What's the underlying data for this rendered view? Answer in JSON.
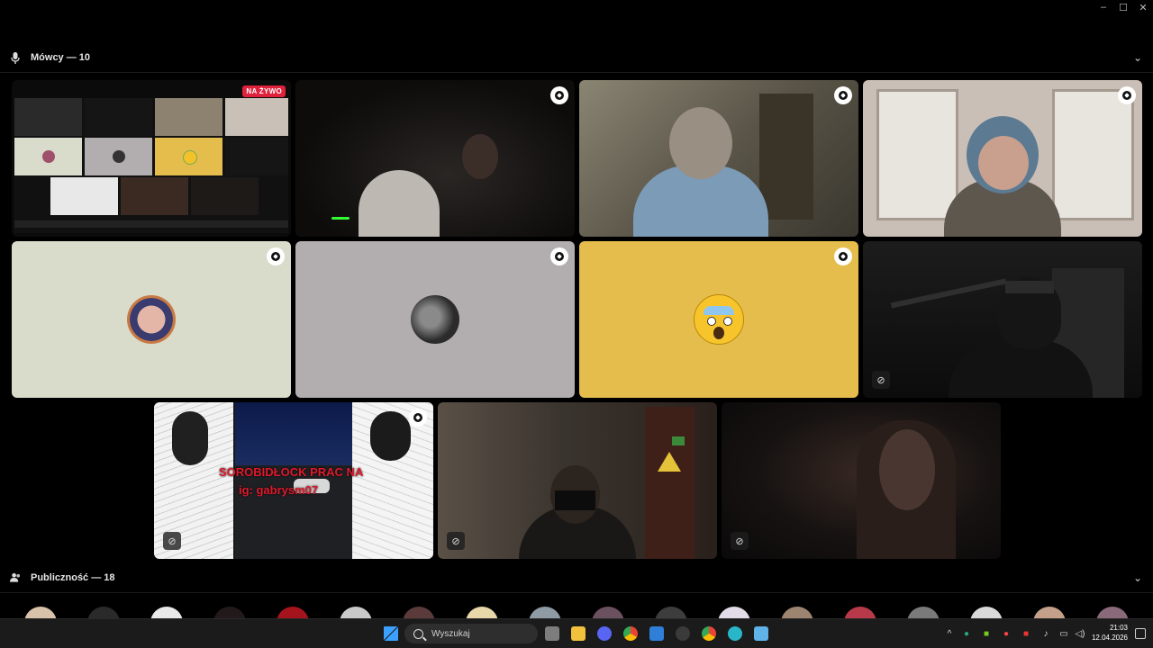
{
  "window_controls": [
    "–",
    "☐",
    "✕"
  ],
  "speakers": {
    "label": "Mówcy — 10",
    "icon": "microphone-icon"
  },
  "audience": {
    "label": "Publiczność — 18",
    "icon": "people-icon"
  },
  "stream_tile": {
    "live_label": "NA ŻYWO"
  },
  "overlay_text": {
    "line1": "SOROBIDŁOCK PRAC NA",
    "line2": "ig: gabrysm07"
  },
  "taskbar": {
    "search_placeholder": "Wyszukaj",
    "time": "21:03",
    "date": "12.04.2026"
  },
  "colors": {
    "live_badge": "#e0213c",
    "tile_light": "#d9dccb",
    "tile_gray": "#b2adae",
    "tile_yellow": "#e5bd4c",
    "background": "#000000"
  }
}
